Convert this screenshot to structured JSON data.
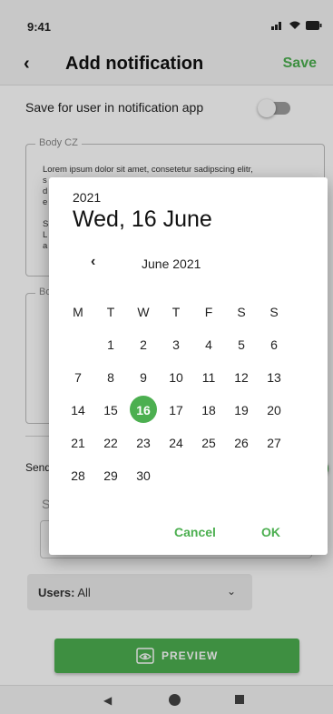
{
  "status_bar": {
    "time": "9:41"
  },
  "app_bar": {
    "back": "‹",
    "title": "Add notification",
    "save_label": "Save"
  },
  "settings": {
    "save_for_user_label": "Save for user in notification app",
    "save_for_user_on": false,
    "send_label": "Send",
    "send_on": true
  },
  "body_cz": {
    "legend": "Body CZ",
    "lines": [
      "Lorem ipsum dolor sit amet, consetetur sadipscing elitr,",
      "s",
      "d",
      "e",
      "",
      "S",
      "L",
      "a"
    ]
  },
  "body_2": {
    "legend": "Bo"
  },
  "s_field": {
    "label": "S"
  },
  "users": {
    "label": "Users:",
    "value": "All"
  },
  "preview": {
    "label": "PREVIEW"
  },
  "date_picker": {
    "year": "2021",
    "selected_date": "Wed, 16 June",
    "month_label": "June 2021",
    "prev_month": "‹",
    "weekdays": [
      "M",
      "T",
      "W",
      "T",
      "F",
      "S",
      "S"
    ],
    "weeks": [
      [
        "",
        "1",
        "2",
        "3",
        "4",
        "5",
        "6"
      ],
      [
        "7",
        "8",
        "9",
        "10",
        "11",
        "12",
        "13"
      ],
      [
        "14",
        "15",
        "16",
        "17",
        "18",
        "19",
        "20"
      ],
      [
        "21",
        "22",
        "23",
        "24",
        "25",
        "26",
        "27"
      ],
      [
        "28",
        "29",
        "30",
        "",
        "",
        "",
        ""
      ]
    ],
    "selected_day": "16",
    "cancel_label": "Cancel",
    "ok_label": "OK"
  },
  "colors": {
    "accent": "#4caf50",
    "scrim": "rgba(0,0,0,0.18)"
  }
}
